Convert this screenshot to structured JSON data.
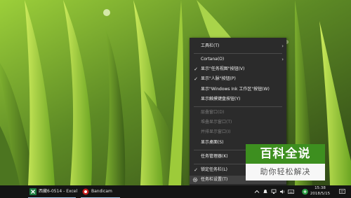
{
  "context_menu": {
    "items": [
      {
        "label": "工具栏(T)",
        "checked": false,
        "disabled": false,
        "submenu": true
      },
      {
        "label": "Cortana(O)",
        "checked": false,
        "disabled": false,
        "submenu": true
      },
      {
        "label": "显示\"任务视图\"按钮(V)",
        "checked": true,
        "disabled": false,
        "submenu": false
      },
      {
        "label": "显示\"人脉\"按钮(P)",
        "checked": true,
        "disabled": false,
        "submenu": false
      },
      {
        "label": "显示\"Windows Ink 工作区\"按钮(W)",
        "checked": false,
        "disabled": false,
        "submenu": false
      },
      {
        "label": "显示触摸键盘按钮(Y)",
        "checked": false,
        "disabled": false,
        "submenu": false
      },
      {
        "label": "层叠窗口(D)",
        "checked": false,
        "disabled": true,
        "submenu": false
      },
      {
        "label": "堆叠显示窗口(T)",
        "checked": false,
        "disabled": true,
        "submenu": false
      },
      {
        "label": "并排显示窗口(I)",
        "checked": false,
        "disabled": true,
        "submenu": false
      },
      {
        "label": "显示桌面(S)",
        "checked": false,
        "disabled": false,
        "submenu": false
      },
      {
        "label": "任务管理器(K)",
        "checked": false,
        "disabled": false,
        "submenu": false
      },
      {
        "label": "锁定任务栏(L)",
        "checked": true,
        "disabled": false,
        "submenu": false
      },
      {
        "label": "任务栏设置(T)",
        "checked": false,
        "disabled": false,
        "submenu": false
      }
    ]
  },
  "watermark": {
    "title": "百科全说",
    "subtitle": "助你轻松解决"
  },
  "taskbar": {
    "apps": [
      {
        "label": "西藏6-0514 - Excel",
        "icon": "excel-icon"
      },
      {
        "label": "Bandicam",
        "icon": "bandicam-icon"
      }
    ],
    "clock": {
      "time": "15:38",
      "date": "2018/5/15"
    },
    "tray_icons": [
      "chevron-up-icon",
      "notification-icon",
      "network-icon",
      "volume-icon",
      "keyboard-icon",
      "ime-icon",
      "action-center-icon"
    ]
  },
  "colors": {
    "menu_bg": "#2b2b2b",
    "taskbar_bg": "#141414",
    "watermark_green": "#3d8f1f"
  }
}
